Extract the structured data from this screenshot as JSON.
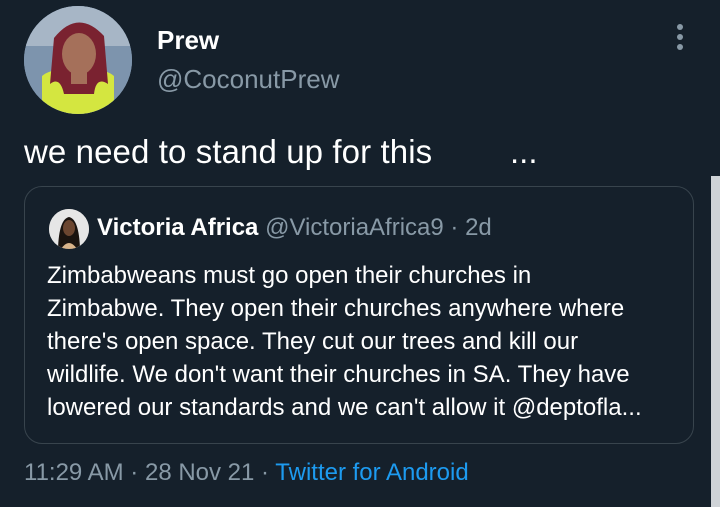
{
  "author": {
    "name": "Prew",
    "handle": "@CoconutPrew"
  },
  "tweet": {
    "text": "we need to stand up for this",
    "ellipsis": "..."
  },
  "quoted": {
    "name": "Victoria Africa",
    "handle": "@VictoriaAfrica9",
    "separator": "·",
    "time": "2d",
    "lines": [
      "Zimbabweans must go open their churches in",
      "Zimbabwe. They open their churches anywhere where",
      "there's open space. They cut our trees and kill our",
      "wildlife. We don't want their churches in SA. They have",
      "lowered our standards and we can't allow it @deptofla..."
    ]
  },
  "meta": {
    "time": "11:29 AM",
    "sep1": "·",
    "date": "28 Nov 21",
    "sep2": "·",
    "source": "Twitter for Android"
  },
  "colors": {
    "background": "#15202b",
    "secondary_text": "#8899a6",
    "link": "#1d9bf0",
    "border": "#38444d"
  },
  "icons": {
    "more": "more-vertical-icon"
  }
}
